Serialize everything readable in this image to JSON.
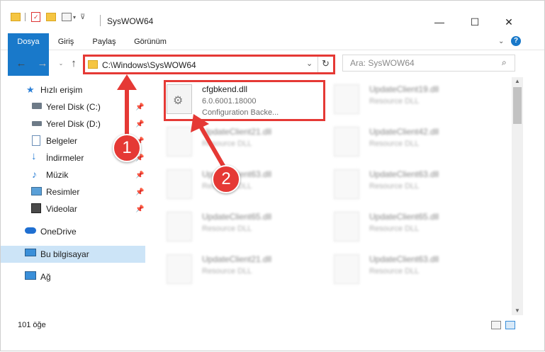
{
  "window": {
    "title": "SysWOW64",
    "minimize_label": "—",
    "maximize_label": "☐",
    "close_label": "✕"
  },
  "ribbon": {
    "tabs": [
      "Dosya",
      "Giriş",
      "Paylaş",
      "Görünüm"
    ],
    "help_label": "?"
  },
  "address": {
    "path": "C:\\Windows\\SysWOW64",
    "search_placeholder": "Ara: SysWOW64"
  },
  "sidebar": {
    "items": [
      {
        "label": "Hızlı erişim",
        "icon": "star-icon"
      },
      {
        "label": "Yerel Disk (C:)",
        "icon": "drive-icon",
        "pinned": true
      },
      {
        "label": "Yerel Disk (D:)",
        "icon": "drive-icon",
        "pinned": true
      },
      {
        "label": "Belgeler",
        "icon": "documents-icon",
        "pinned": true
      },
      {
        "label": "İndirmeler",
        "icon": "download-icon",
        "pinned": true
      },
      {
        "label": "Müzik",
        "icon": "music-icon",
        "pinned": true
      },
      {
        "label": "Resimler",
        "icon": "pictures-icon",
        "pinned": true
      },
      {
        "label": "Videolar",
        "icon": "videos-icon",
        "pinned": true
      },
      {
        "label": "OneDrive",
        "icon": "cloud-icon"
      },
      {
        "label": "Bu bilgisayar",
        "icon": "computer-icon",
        "selected": true
      },
      {
        "label": "Ağ",
        "icon": "network-icon"
      }
    ]
  },
  "files": [
    {
      "name": "cfgbkend.dll",
      "version": "6.0.6001.18000",
      "description": "Configuration Backe...",
      "highlighted": true
    },
    {
      "name": "UpdateClient19.dll",
      "description": "Resource DLL"
    },
    {
      "name": "UpdateClient21.dll",
      "description": "Resource DLL"
    },
    {
      "name": "UpdateClient42.dll",
      "description": "Resource DLL"
    },
    {
      "name": "UpdateClient63.dll",
      "description": "Resource DLL"
    },
    {
      "name": "UpdateClient63.dll",
      "description": "Resource DLL"
    },
    {
      "name": "UpdateClient65.dll",
      "description": "Resource DLL"
    },
    {
      "name": "UpdateClient65.dll",
      "description": "Resource DLL"
    },
    {
      "name": "UpdateClient21.dll",
      "description": "Resource DLL"
    },
    {
      "name": "UpdateClient63.dll",
      "description": "Resource DLL"
    }
  ],
  "status": {
    "item_count": "101 öğe"
  },
  "annotations": {
    "step1": "1",
    "step2": "2",
    "color": "#e53935"
  }
}
